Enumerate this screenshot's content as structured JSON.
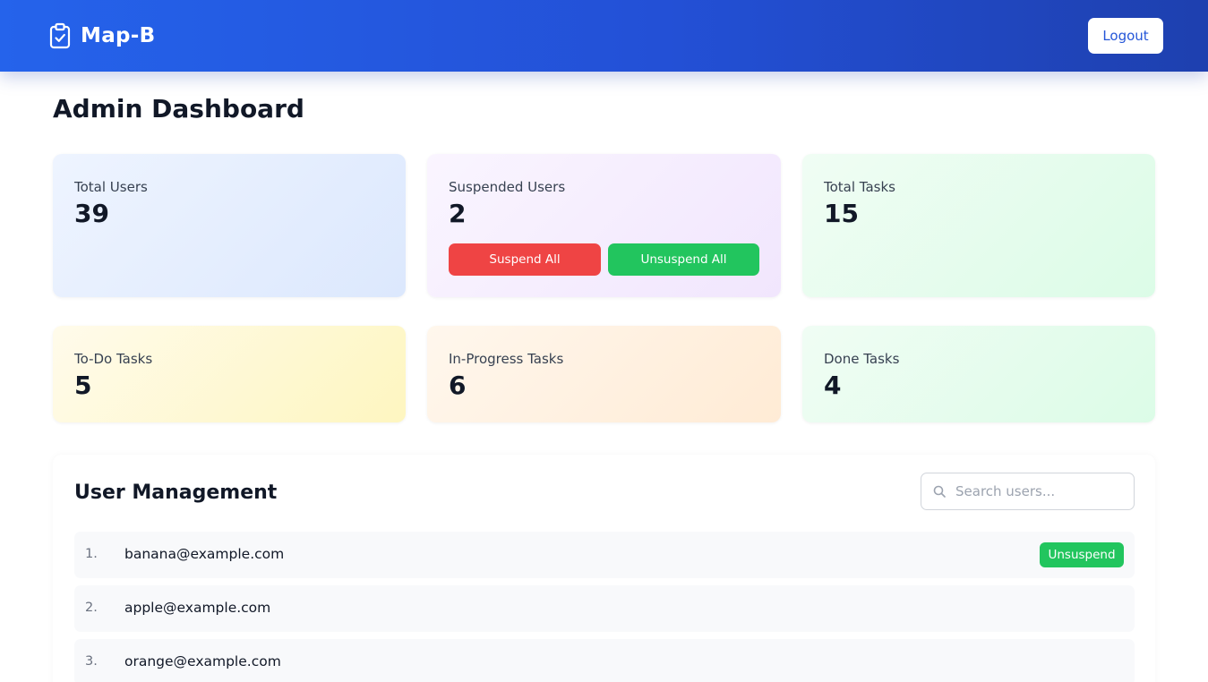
{
  "header": {
    "brand_icon": "clipboard-check-icon",
    "brand_name": "Map-B",
    "logout_label": "Logout",
    "gradient_colors": [
      "#2563eb",
      "#1e40af"
    ]
  },
  "page": {
    "title": "Admin Dashboard"
  },
  "stats": {
    "total_users": {
      "label": "Total Users",
      "value": "39"
    },
    "suspended_users": {
      "label": "Suspended Users",
      "value": "2",
      "suspend_all_label": "Suspend All",
      "unsuspend_all_label": "Unsuspend All"
    },
    "total_tasks": {
      "label": "Total Tasks",
      "value": "15"
    },
    "todo_tasks": {
      "label": "To-Do Tasks",
      "value": "5"
    },
    "inprogress_tasks": {
      "label": "In-Progress Tasks",
      "value": "6"
    },
    "done_tasks": {
      "label": "Done Tasks",
      "value": "4"
    }
  },
  "user_management": {
    "title": "User Management",
    "search_placeholder": "Search users...",
    "search_icon": "search-icon",
    "users": [
      {
        "index": "1.",
        "email": "banana@example.com",
        "action_label": "Unsuspend"
      },
      {
        "index": "2.",
        "email": "apple@example.com"
      },
      {
        "index": "3.",
        "email": "orange@example.com"
      }
    ]
  },
  "colors": {
    "danger": "#ef4444",
    "success": "#22c55e",
    "primary": "#2563eb"
  }
}
